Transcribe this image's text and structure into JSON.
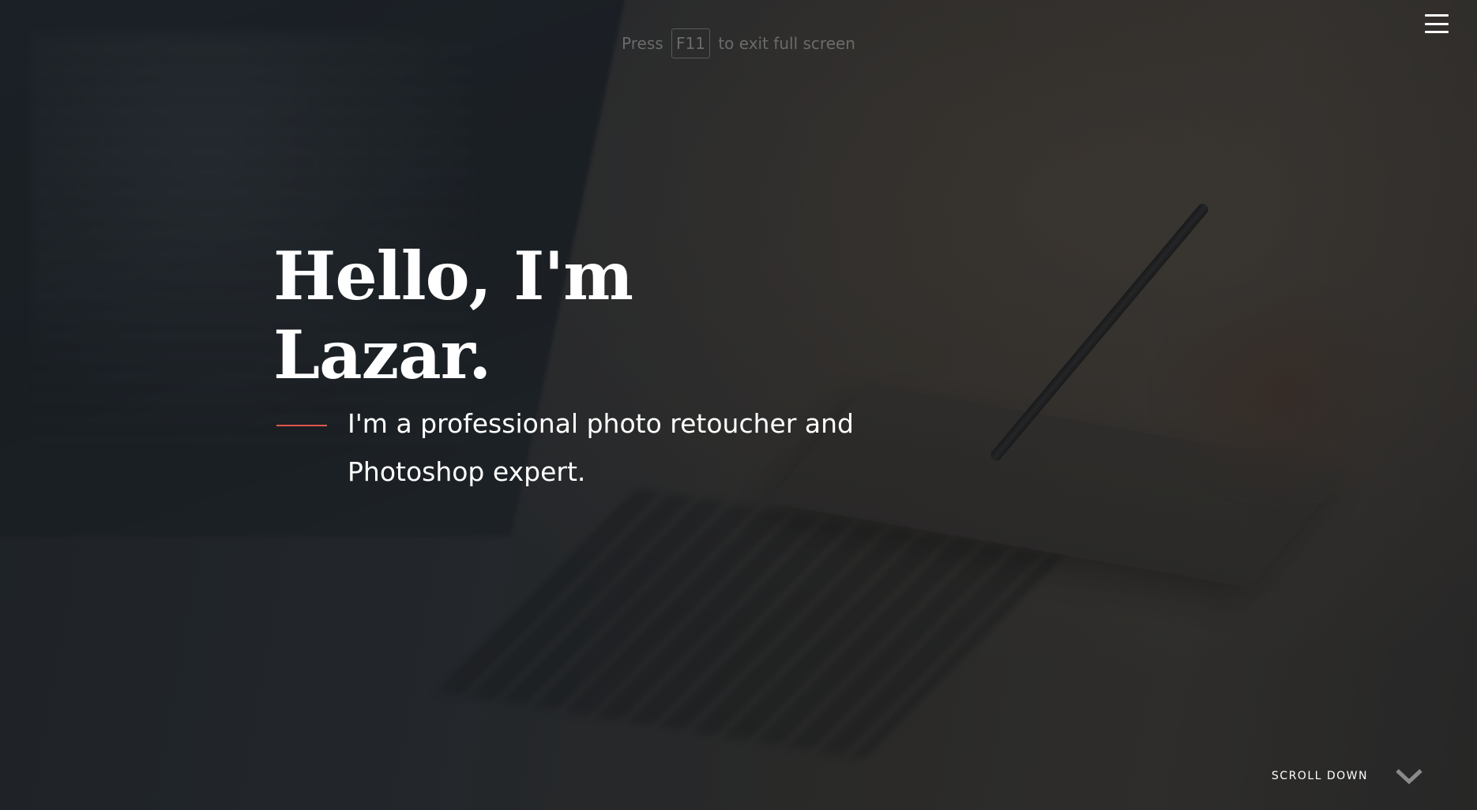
{
  "fullscreen_hint": {
    "prefix": "Press",
    "key": "F11",
    "suffix": "to exit full screen"
  },
  "menu": {
    "icon": "hamburger-menu-icon"
  },
  "hero": {
    "headline": "Hello, I'm Lazar.",
    "tagline": "I'm a professional photo retoucher and Photoshop expert.",
    "accent_color": "#e2574c"
  },
  "scroll_down": {
    "label": "SCROLL DOWN",
    "icon": "chevron-down-icon"
  }
}
